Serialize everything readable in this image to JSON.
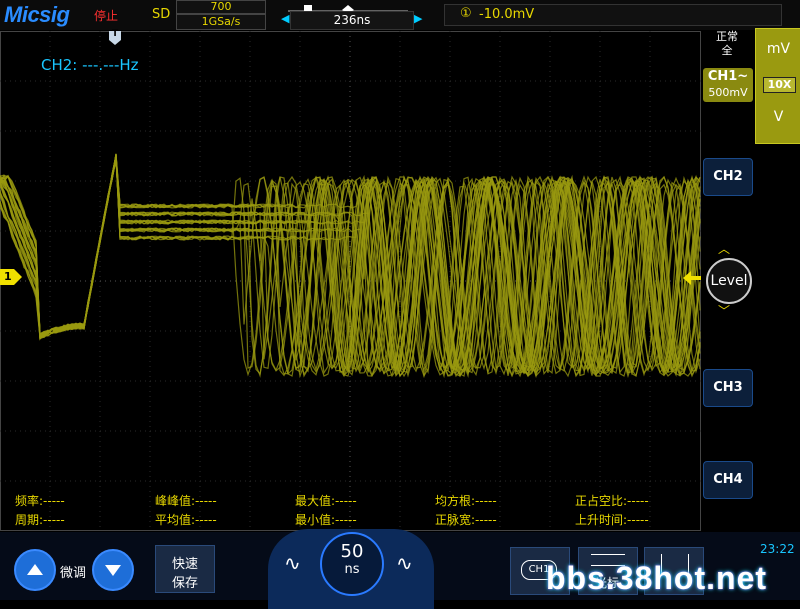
{
  "header": {
    "logo": "Micsig",
    "run_status": "停止",
    "acq_mode": "SD",
    "memory_depth": "700",
    "sample_rate": "1GSa/s",
    "time_offset": "236ns",
    "trigger_source_badge": "①",
    "trigger_level": "-10.0mV",
    "trigger_edge_icon": "rising-edge-icon"
  },
  "display": {
    "freq_readout": "CH2: ---.---Hz",
    "trigger_marker": "T",
    "ch1_marker": "1",
    "waveform_color": "#9a9a10",
    "grid_color": "#2a2a2a"
  },
  "right_panel": {
    "trigger_mode_line1": "正常",
    "trigger_mode_line2": "全",
    "ch1_label": "CH1",
    "ch1_coupling": "~",
    "ch1_scale": "500mV",
    "unit_up": "mV",
    "probe": "10X",
    "unit_down": "V",
    "ch2_label": "CH2",
    "level_label": "Level",
    "ch3_label": "CH3",
    "ch4_label": "CH4"
  },
  "measurements": [
    {
      "label": "频率:",
      "value": "-----"
    },
    {
      "label": "周期:",
      "value": "-----"
    },
    {
      "label": "峰峰值:",
      "value": "-----"
    },
    {
      "label": "平均值:",
      "value": "-----"
    },
    {
      "label": "最大值:",
      "value": "-----"
    },
    {
      "label": "最小值:",
      "value": "-----"
    },
    {
      "label": "均方根:",
      "value": "-----"
    },
    {
      "label": "正脉宽:",
      "value": "-----"
    },
    {
      "label": "正占空比:",
      "value": "-----"
    },
    {
      "label": "上升时间:",
      "value": "-----"
    }
  ],
  "bottom": {
    "fine_label": "微调",
    "save_line1": "快速",
    "save_line2": "保存",
    "timebase_value": "50",
    "timebase_unit": "ns",
    "ch1_tab": "CH1",
    "cursor_label": "光标",
    "clock": "23:22",
    "watermark": "bbs.38hot.net"
  },
  "colors": {
    "accent_blue": "#1e6ed8",
    "ch1_yellow": "#e8d800",
    "readout_cyan": "#19c6ff"
  }
}
